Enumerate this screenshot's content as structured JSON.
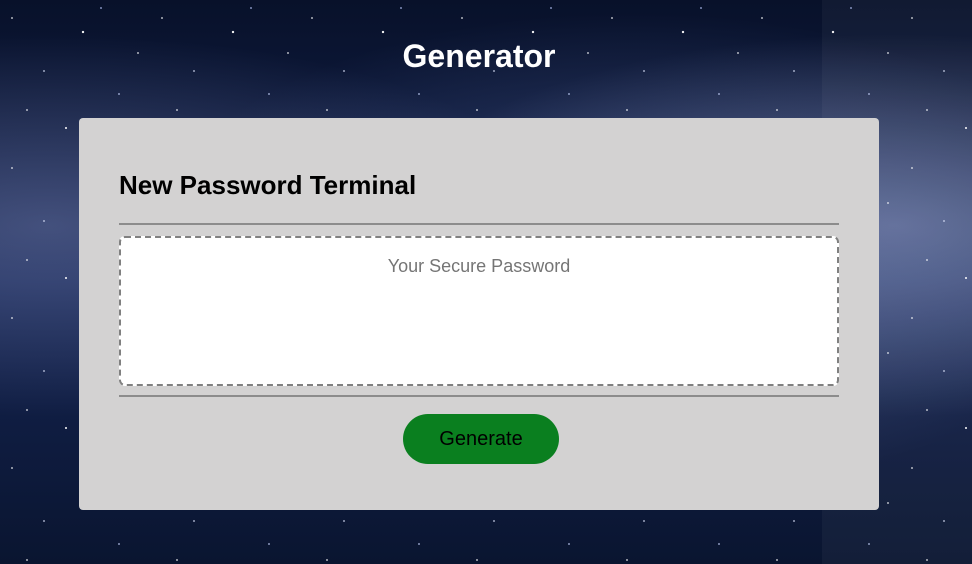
{
  "header": {
    "title": "Generator"
  },
  "card": {
    "title": "New Password Terminal",
    "password_field": {
      "value": "",
      "placeholder": "Your Secure Password"
    },
    "generate_label": "Generate"
  },
  "colors": {
    "card_background": "#d3d2d2",
    "button_green": "#0a7f1f",
    "title_text": "#ffffff"
  }
}
